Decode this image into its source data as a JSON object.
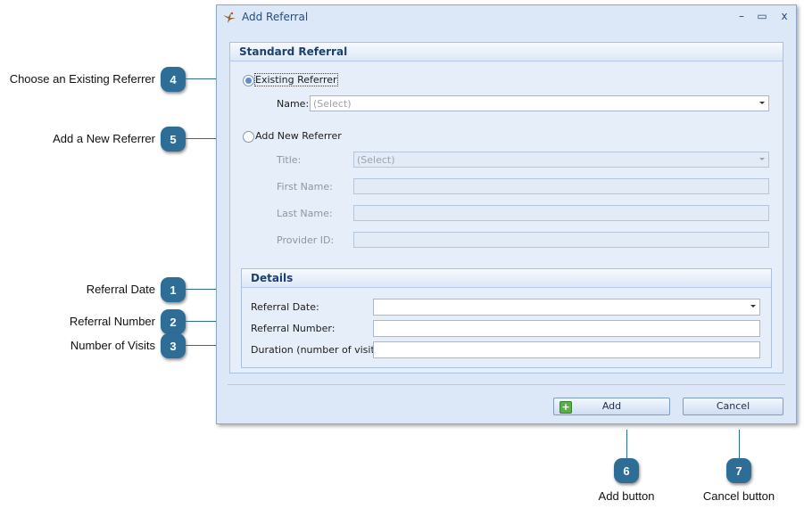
{
  "window": {
    "title": "Add Referral",
    "minimize_glyph": "–",
    "maximize_glyph": "▭",
    "close_glyph": "x"
  },
  "standard_referral": {
    "title": "Standard Referral",
    "existing_referrer_label": "Existing Referrer",
    "name_label": "Name:",
    "name_value": "(Select)",
    "add_new_referrer_label": "Add New Referrer",
    "title_label": "Title:",
    "title_value": "(Select)",
    "first_name_label": "First Name:",
    "last_name_label": "Last Name:",
    "provider_id_label": "Provider ID:"
  },
  "details": {
    "title": "Details",
    "referral_date_label": "Referral Date:",
    "referral_number_label": "Referral Number:",
    "duration_label": "Duration (number of visits):"
  },
  "buttons": {
    "add_label": "Add",
    "cancel_label": "Cancel"
  },
  "callouts": {
    "c1": {
      "number": "1",
      "text": "Referral Date"
    },
    "c2": {
      "number": "2",
      "text": "Referral Number"
    },
    "c3": {
      "number": "3",
      "text": "Number of Visits"
    },
    "c4": {
      "number": "4",
      "text": "Choose an Existing Referrer"
    },
    "c5": {
      "number": "5",
      "text": "Add a New Referrer"
    },
    "c6": {
      "number": "6",
      "text": "Add button"
    },
    "c7": {
      "number": "7",
      "text": "Cancel button"
    }
  },
  "icons": {
    "app": "bird-icon",
    "add": "add-plus-icon",
    "dropdown": "chevron-down-icon"
  },
  "colors": {
    "callout_badge": "#2d6d96",
    "window_bg": "#dce8f7",
    "group_title": "#1d3f6e"
  }
}
